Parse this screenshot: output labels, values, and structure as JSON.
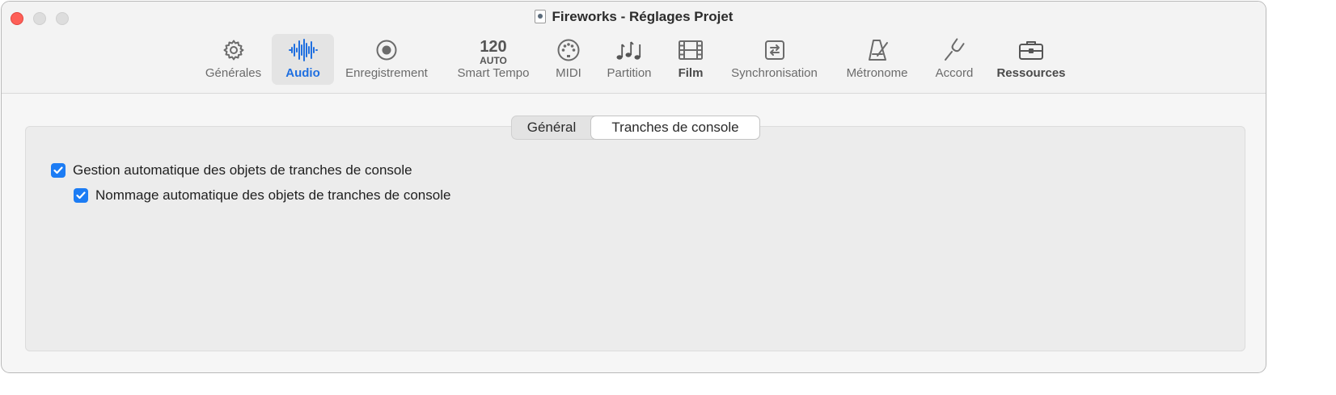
{
  "window": {
    "title": "Fireworks - Réglages Projet"
  },
  "toolbar": {
    "items": [
      {
        "label": "Générales",
        "icon": "gear-icon"
      },
      {
        "label": "Audio",
        "icon": "waveform-icon",
        "selected": true
      },
      {
        "label": "Enregistrement",
        "icon": "record-icon"
      },
      {
        "label": "Smart Tempo",
        "icon": "tempo-icon",
        "icon_text_top": "120",
        "icon_text_bottom": "AUTO"
      },
      {
        "label": "MIDI",
        "icon": "midi-icon"
      },
      {
        "label": "Partition",
        "icon": "notes-icon"
      },
      {
        "label": "Film",
        "icon": "film-icon"
      },
      {
        "label": "Synchronisation",
        "icon": "sync-icon"
      },
      {
        "label": "Métronome",
        "icon": "metronome-icon"
      },
      {
        "label": "Accord",
        "icon": "tuning-fork-icon"
      },
      {
        "label": "Ressources",
        "icon": "briefcase-icon"
      }
    ]
  },
  "tabs": [
    {
      "label": "Général",
      "selected": false
    },
    {
      "label": "Tranches de console",
      "selected": true
    }
  ],
  "options": [
    {
      "label": "Gestion automatique des objets de tranches de console",
      "checked": true
    },
    {
      "label": "Nommage automatique des objets de tranches de console",
      "checked": true
    }
  ],
  "colors": {
    "accent": "#1c7cf4",
    "selected_label": "#1f6fe0",
    "close_button": "#fe5f57"
  }
}
